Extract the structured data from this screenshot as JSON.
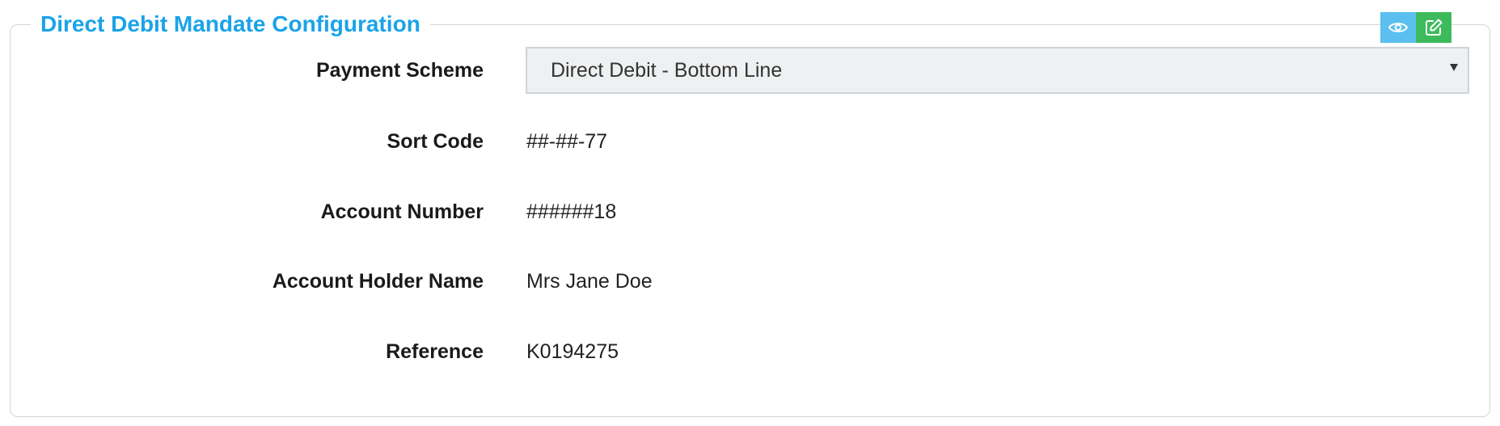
{
  "panel": {
    "title": "Direct Debit Mandate Configuration",
    "actions": [
      {
        "icon": "eye-icon",
        "color": "#5bc0ef"
      },
      {
        "icon": "edit-icon",
        "color": "#3dbb5c"
      }
    ]
  },
  "fields": {
    "payment_scheme": {
      "label": "Payment Scheme",
      "value": "Direct Debit - Bottom Line"
    },
    "sort_code": {
      "label": "Sort Code",
      "value": "##-##-77"
    },
    "account_number": {
      "label": "Account Number",
      "value": "######18"
    },
    "account_holder_name": {
      "label": "Account Holder Name",
      "value": "Mrs Jane Doe"
    },
    "reference": {
      "label": "Reference",
      "value": "K0194275"
    }
  },
  "colors": {
    "title": "#1aa3e8",
    "view_button": "#5bc0ef",
    "edit_button": "#3dbb5c",
    "select_background": "#eef0f1",
    "border": "#d4d4d4"
  }
}
